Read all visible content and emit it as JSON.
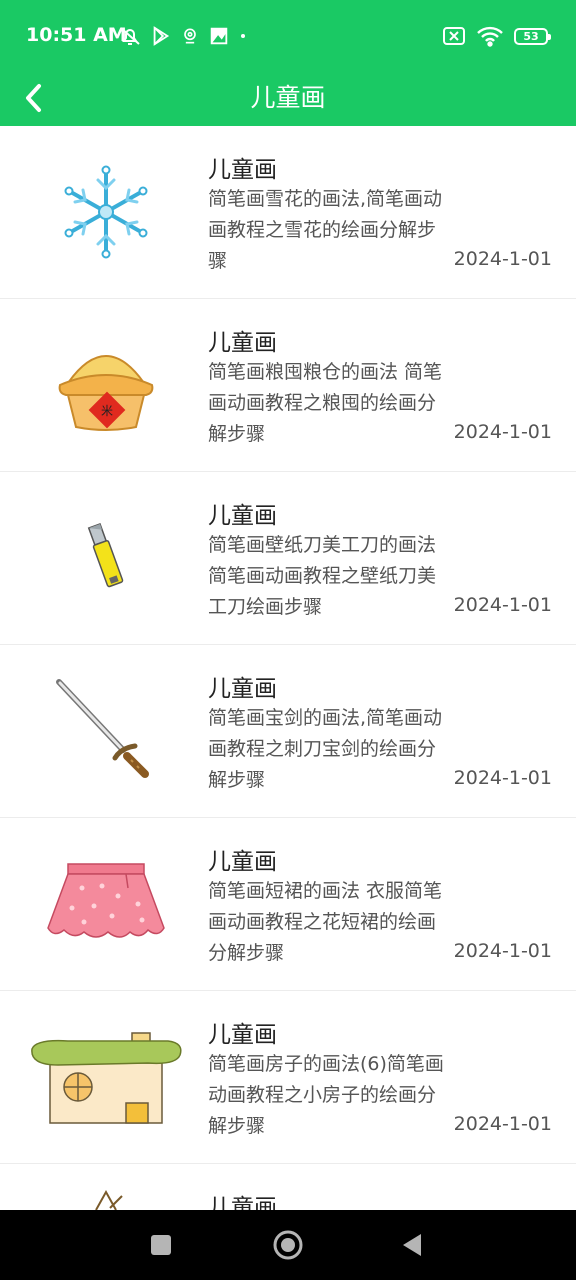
{
  "status_bar": {
    "time": "10:51 AM",
    "battery": "53",
    "icons_left": [
      "mute-bell-icon",
      "play-store-icon",
      "location-pin-icon",
      "photo-icon",
      "dot-icon"
    ],
    "icons_right": [
      "sim-off-icon",
      "wifi-icon",
      "battery-icon"
    ]
  },
  "app_bar": {
    "title": "儿童画",
    "back_icon": "chevron-left-icon",
    "color": "#1ac964"
  },
  "list": {
    "items": [
      {
        "title": "儿童画",
        "description": "简笔画雪花的画法,简笔画动画教程之雪花的绘画分解步骤",
        "date": "2024-1-01",
        "image": "snowflake"
      },
      {
        "title": "儿童画",
        "description": "简笔画粮囤粮仓的画法 简笔画动画教程之粮囤的绘画分解步骤",
        "date": "2024-1-01",
        "image": "granary"
      },
      {
        "title": "儿童画",
        "description": "简笔画壁纸刀美工刀的画法 简笔画动画教程之壁纸刀美工刀绘画步骤",
        "date": "2024-1-01",
        "image": "utility-knife"
      },
      {
        "title": "儿童画",
        "description": "简笔画宝剑的画法,简笔画动画教程之刺刀宝剑的绘画分解步骤",
        "date": "2024-1-01",
        "image": "sword"
      },
      {
        "title": "儿童画",
        "description": "简笔画短裙的画法 衣服简笔画动画教程之花短裙的绘画分解步骤",
        "date": "2024-1-01",
        "image": "skirt"
      },
      {
        "title": "儿童画",
        "description": "简笔画房子的画法(6)简笔画动画教程之小房子的绘画分解步骤",
        "date": "2024-1-01",
        "image": "house"
      },
      {
        "title": "儿童画",
        "description": "",
        "date": "",
        "image": "partial"
      }
    ]
  },
  "nav_bar": {
    "buttons": [
      "recents-square-icon",
      "home-circle-icon",
      "back-triangle-icon"
    ]
  }
}
